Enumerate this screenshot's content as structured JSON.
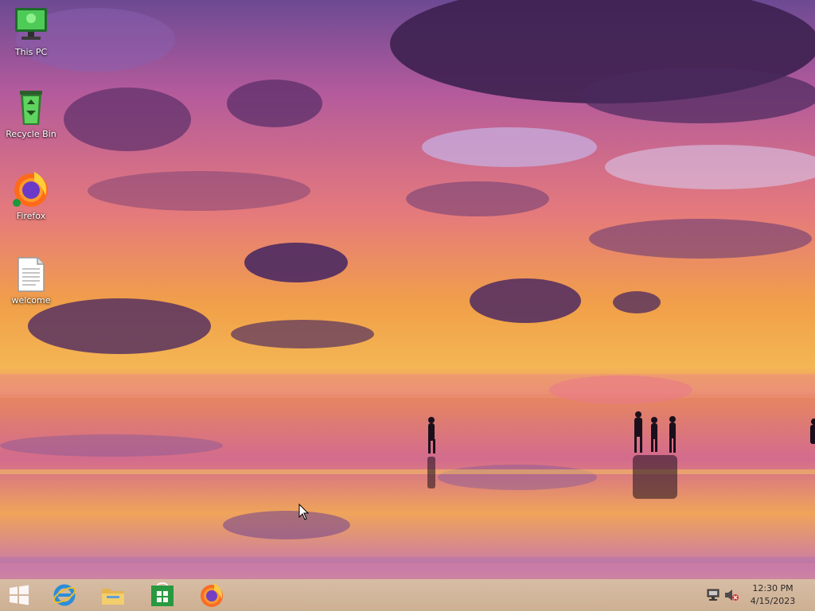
{
  "desktop": {
    "icons": [
      {
        "label": "This PC",
        "icon": "this-pc-icon"
      },
      {
        "label": "Recycle Bin",
        "icon": "recycle-bin-icon"
      },
      {
        "label": "Firefox",
        "icon": "firefox-icon"
      },
      {
        "label": "welcome",
        "icon": "text-document-icon"
      }
    ]
  },
  "taskbar": {
    "buttons": [
      {
        "icon": "windows-start-icon"
      },
      {
        "icon": "internet-explorer-icon"
      },
      {
        "icon": "file-explorer-icon"
      },
      {
        "icon": "store-icon"
      },
      {
        "icon": "firefox-icon"
      }
    ],
    "tray": {
      "icons": [
        "network-icon",
        "volume-muted-icon"
      ],
      "time": "12:30 PM",
      "date": "4/15/2023"
    }
  },
  "colors": {
    "taskbar": "#d4bc9e",
    "sky_top": "#7a4f9c",
    "sunset_orange": "#f2a040",
    "water_pink": "#e58aa0"
  }
}
